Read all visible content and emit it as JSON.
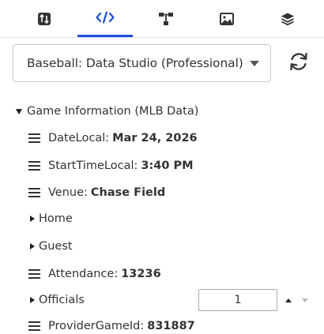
{
  "tabs": [
    {
      "icon": "sort-arrows-icon",
      "active": false
    },
    {
      "icon": "code-icon",
      "active": true
    },
    {
      "icon": "hierarchy-icon",
      "active": false
    },
    {
      "icon": "image-icon",
      "active": false
    },
    {
      "icon": "layers-icon",
      "active": false
    }
  ],
  "accent_color": "#1e4fd8",
  "source_select": {
    "value": "Baseball: Data Studio (Professional)"
  },
  "refresh_icon": "refresh-icon",
  "tree": {
    "root_label": "Game Information (MLB Data)",
    "items": {
      "date_local": {
        "label": "DateLocal:",
        "value": "Mar 24, 2026"
      },
      "start_time_local": {
        "label": "StartTimeLocal:",
        "value": "3:40 PM"
      },
      "venue": {
        "label": "Venue:",
        "value": "Chase Field"
      },
      "home": {
        "label": "Home"
      },
      "guest": {
        "label": "Guest"
      },
      "attendance": {
        "label": "Attendance:",
        "value": "13236"
      },
      "officials": {
        "label": "Officials",
        "index_value": "1"
      },
      "provider_game_id": {
        "label": "ProviderGameId:",
        "value": "831887"
      }
    }
  }
}
